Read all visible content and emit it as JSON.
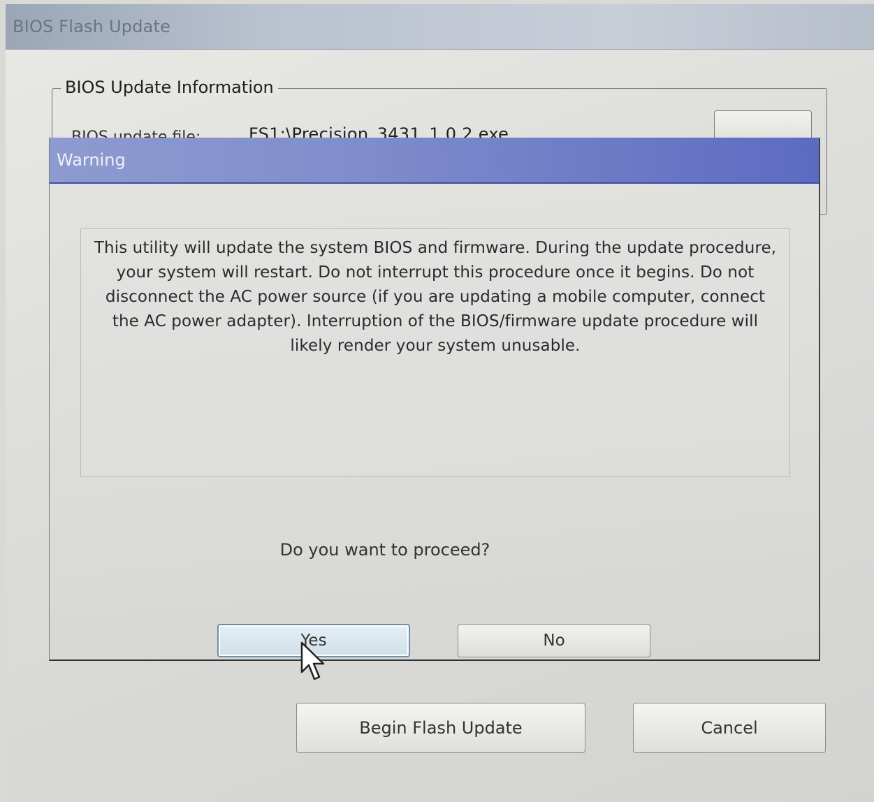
{
  "window": {
    "title": "BIOS Flash Update"
  },
  "info_group": {
    "legend": "BIOS Update Information",
    "file_label": "BIOS update file:",
    "file_value": "FS1:\\Precision_3431_1.0.2.exe"
  },
  "footer": {
    "begin_label": "Begin Flash Update",
    "cancel_label": "Cancel"
  },
  "warning_dialog": {
    "title": "Warning",
    "message": "This utility will update the system BIOS and firmware.  During the update procedure, your system will restart. Do not interrupt this procedure once it begins.  Do not disconnect the AC power source (if you are updating a mobile computer, connect the AC power adapter).  Interruption of the BIOS/firmware update procedure will likely render your system unusable.",
    "question": "Do you want to proceed?",
    "yes_label": "Yes",
    "no_label": "No"
  },
  "icons": {
    "cursor": "mouse-pointer-icon"
  },
  "colors": {
    "dialog_title_bar": "#6b79c6",
    "window_title_bar": "#b9c2cf",
    "focused_button": "#cfe0e8"
  }
}
